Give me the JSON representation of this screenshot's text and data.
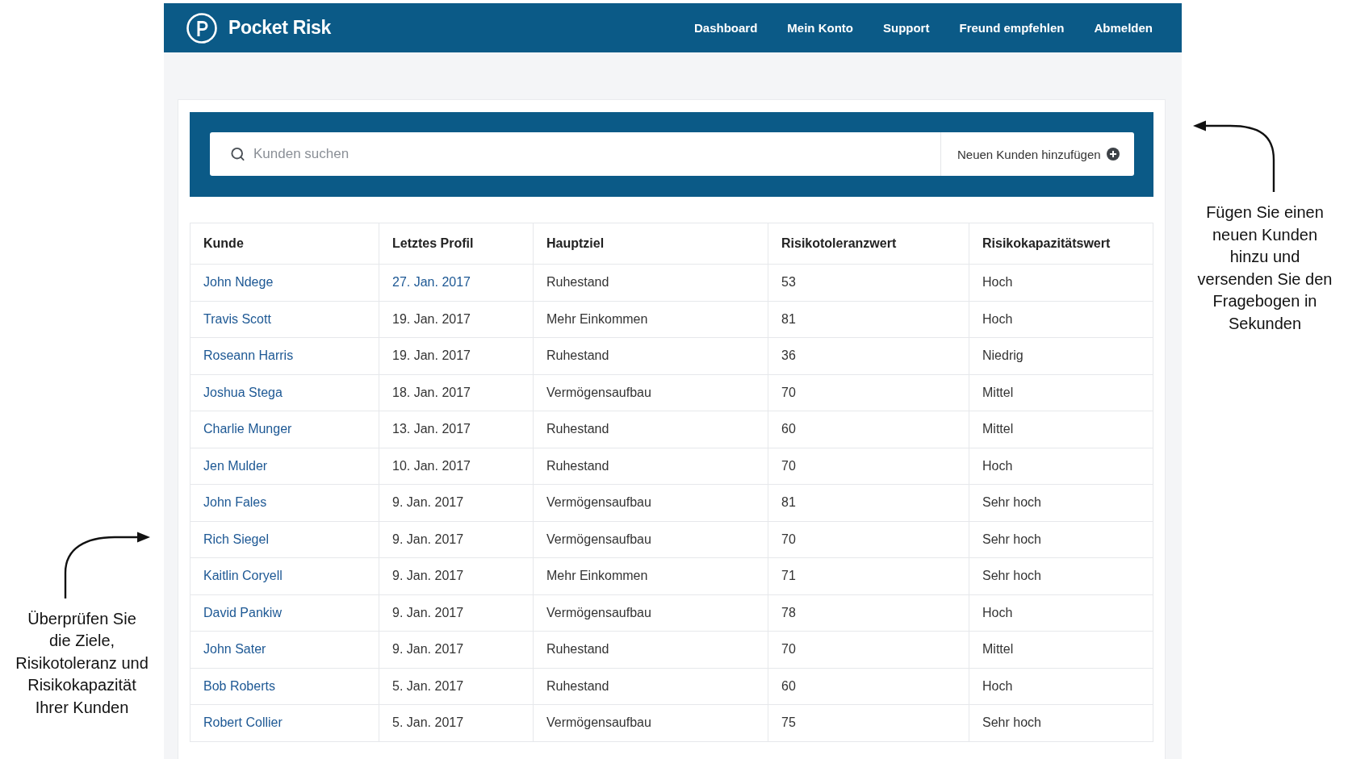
{
  "header": {
    "brand": "Pocket Risk",
    "nav": [
      "Dashboard",
      "Mein Konto",
      "Support",
      "Freund empfehlen",
      "Abmelden"
    ]
  },
  "search": {
    "placeholder": "Kunden suchen",
    "add_button": "Neuen Kunden hinzufügen"
  },
  "table": {
    "columns": [
      "Kunde",
      "Letztes Profil",
      "Hauptziel",
      "Risikotoleranzwert",
      "Risikokapazitätswert"
    ],
    "rows": [
      {
        "client": "John Ndege",
        "last_profile": "27. Jan. 2017",
        "last_profile_linked": true,
        "goal": "Ruhestand",
        "tolerance": "53",
        "capacity": "Hoch"
      },
      {
        "client": "Travis Scott",
        "last_profile": "19. Jan. 2017",
        "last_profile_linked": false,
        "goal": "Mehr Einkommen",
        "tolerance": "81",
        "capacity": "Hoch"
      },
      {
        "client": "Roseann Harris",
        "last_profile": "19. Jan. 2017",
        "last_profile_linked": false,
        "goal": "Ruhestand",
        "tolerance": "36",
        "capacity": "Niedrig"
      },
      {
        "client": "Joshua Stega",
        "last_profile": "18. Jan. 2017",
        "last_profile_linked": false,
        "goal": "Vermögensaufbau",
        "tolerance": "70",
        "capacity": "Mittel"
      },
      {
        "client": "Charlie Munger",
        "last_profile": "13. Jan. 2017",
        "last_profile_linked": false,
        "goal": "Ruhestand",
        "tolerance": "60",
        "capacity": "Mittel"
      },
      {
        "client": "Jen Mulder",
        "last_profile": "10. Jan. 2017",
        "last_profile_linked": false,
        "goal": "Ruhestand",
        "tolerance": "70",
        "capacity": "Hoch"
      },
      {
        "client": "John Fales",
        "last_profile": "9. Jan. 2017",
        "last_profile_linked": false,
        "goal": "Vermögensaufbau",
        "tolerance": "81",
        "capacity": "Sehr hoch"
      },
      {
        "client": "Rich Siegel",
        "last_profile": "9. Jan. 2017",
        "last_profile_linked": false,
        "goal": "Vermögensaufbau",
        "tolerance": "70",
        "capacity": "Sehr hoch"
      },
      {
        "client": "Kaitlin Coryell",
        "last_profile": "9. Jan. 2017",
        "last_profile_linked": false,
        "goal": "Mehr Einkommen",
        "tolerance": "71",
        "capacity": "Sehr hoch"
      },
      {
        "client": "David Pankiw",
        "last_profile": "9. Jan. 2017",
        "last_profile_linked": false,
        "goal": "Vermögensaufbau",
        "tolerance": "78",
        "capacity": "Hoch"
      },
      {
        "client": "John Sater",
        "last_profile": "9. Jan. 2017",
        "last_profile_linked": false,
        "goal": "Ruhestand",
        "tolerance": "70",
        "capacity": "Mittel"
      },
      {
        "client": "Bob Roberts",
        "last_profile": "5. Jan. 2017",
        "last_profile_linked": false,
        "goal": "Ruhestand",
        "tolerance": "60",
        "capacity": "Hoch"
      },
      {
        "client": "Robert Collier",
        "last_profile": "5. Jan. 2017",
        "last_profile_linked": false,
        "goal": "Vermögensaufbau",
        "tolerance": "75",
        "capacity": "Sehr hoch"
      }
    ]
  },
  "annotations": {
    "right": "Fügen Sie einen\nneuen Kunden\nhinzu und\nversenden Sie den\nFragebogen in\nSekunden",
    "left": "Überprüfen Sie\ndie Ziele,\nRisikotoleranz und\nRisikokapazität\nIhrer Kunden"
  }
}
